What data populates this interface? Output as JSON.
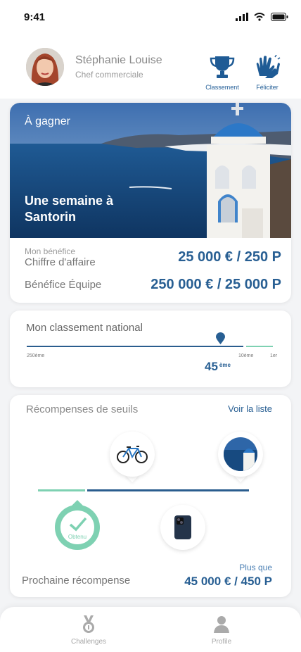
{
  "status": {
    "time": "9:41"
  },
  "user": {
    "name": "Stéphanie Louise",
    "role": "Chef commerciale"
  },
  "actions": {
    "ranking_label": "Classement",
    "congrats_label": "Féliciter"
  },
  "prize": {
    "tag": "À gagner",
    "title": "Une semaine à Santorin",
    "profit_label_small": "Mon bénéfice",
    "revenue_label": "Chiffre d'affaire",
    "revenue_value": "25 000 € / 250 P",
    "team_label": "Bénéfice Équipe",
    "team_value": "250 000 € / 25 000 P"
  },
  "ranking": {
    "title": "Mon classement national",
    "tick_start": "250ème",
    "tick_10": "10ème",
    "tick_first": "1er",
    "position": "45",
    "position_suffix": "ème"
  },
  "rewards": {
    "title": "Récompenses de seuils",
    "see_list": "Voir la liste",
    "obtained_label": "Obtenu",
    "next_label": "Prochaine récompense",
    "next_more": "Plus que",
    "next_value": "45 000 € / 450 P"
  },
  "tabs": {
    "challenges": "Challenges",
    "profile": "Profile"
  },
  "colors": {
    "primary": "#285f93",
    "accent_green": "#7ed1b2",
    "muted": "#a8a8a8"
  },
  "icons": [
    "signal-icon",
    "wifi-icon",
    "battery-icon",
    "trophy-icon",
    "clap-icon",
    "location-pin-icon",
    "bicycle-icon",
    "santorini-icon",
    "phone-icon",
    "check-icon",
    "medal-icon",
    "user-icon"
  ]
}
